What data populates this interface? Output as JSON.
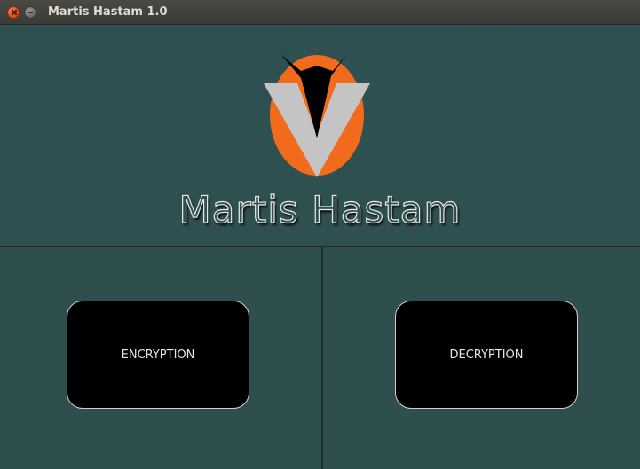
{
  "window": {
    "title": "Martis Hastam 1.0"
  },
  "header": {
    "brand_name": "Martis Hastam",
    "logo_icon": "martis-hastam-logo",
    "logo_colors": {
      "oval": "#f26b1d",
      "chevron": "#c4c4c4",
      "dart": "#000000"
    }
  },
  "actions": {
    "encryption_label": "ENCRYPTION",
    "decryption_label": "DECRYPTION"
  },
  "colors": {
    "background": "#2f4f4f",
    "button_fill": "#000000",
    "button_text": "#e6e6e6"
  }
}
